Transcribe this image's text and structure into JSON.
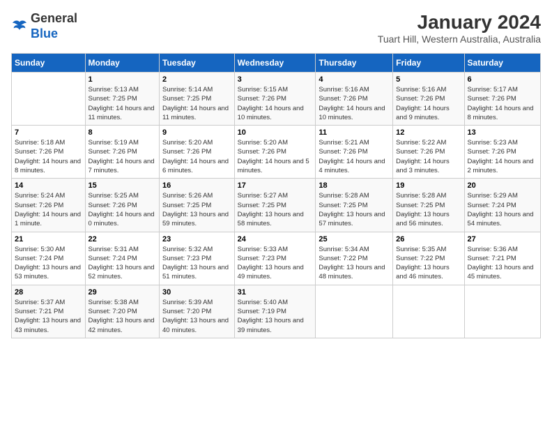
{
  "logo": {
    "general": "General",
    "blue": "Blue"
  },
  "title": "January 2024",
  "subtitle": "Tuart Hill, Western Australia, Australia",
  "days_of_week": [
    "Sunday",
    "Monday",
    "Tuesday",
    "Wednesday",
    "Thursday",
    "Friday",
    "Saturday"
  ],
  "weeks": [
    [
      {
        "day": "",
        "sunrise": "",
        "sunset": "",
        "daylight": ""
      },
      {
        "day": "1",
        "sunrise": "Sunrise: 5:13 AM",
        "sunset": "Sunset: 7:25 PM",
        "daylight": "Daylight: 14 hours and 11 minutes."
      },
      {
        "day": "2",
        "sunrise": "Sunrise: 5:14 AM",
        "sunset": "Sunset: 7:25 PM",
        "daylight": "Daylight: 14 hours and 11 minutes."
      },
      {
        "day": "3",
        "sunrise": "Sunrise: 5:15 AM",
        "sunset": "Sunset: 7:26 PM",
        "daylight": "Daylight: 14 hours and 10 minutes."
      },
      {
        "day": "4",
        "sunrise": "Sunrise: 5:16 AM",
        "sunset": "Sunset: 7:26 PM",
        "daylight": "Daylight: 14 hours and 10 minutes."
      },
      {
        "day": "5",
        "sunrise": "Sunrise: 5:16 AM",
        "sunset": "Sunset: 7:26 PM",
        "daylight": "Daylight: 14 hours and 9 minutes."
      },
      {
        "day": "6",
        "sunrise": "Sunrise: 5:17 AM",
        "sunset": "Sunset: 7:26 PM",
        "daylight": "Daylight: 14 hours and 8 minutes."
      }
    ],
    [
      {
        "day": "7",
        "sunrise": "Sunrise: 5:18 AM",
        "sunset": "Sunset: 7:26 PM",
        "daylight": "Daylight: 14 hours and 8 minutes."
      },
      {
        "day": "8",
        "sunrise": "Sunrise: 5:19 AM",
        "sunset": "Sunset: 7:26 PM",
        "daylight": "Daylight: 14 hours and 7 minutes."
      },
      {
        "day": "9",
        "sunrise": "Sunrise: 5:20 AM",
        "sunset": "Sunset: 7:26 PM",
        "daylight": "Daylight: 14 hours and 6 minutes."
      },
      {
        "day": "10",
        "sunrise": "Sunrise: 5:20 AM",
        "sunset": "Sunset: 7:26 PM",
        "daylight": "Daylight: 14 hours and 5 minutes."
      },
      {
        "day": "11",
        "sunrise": "Sunrise: 5:21 AM",
        "sunset": "Sunset: 7:26 PM",
        "daylight": "Daylight: 14 hours and 4 minutes."
      },
      {
        "day": "12",
        "sunrise": "Sunrise: 5:22 AM",
        "sunset": "Sunset: 7:26 PM",
        "daylight": "Daylight: 14 hours and 3 minutes."
      },
      {
        "day": "13",
        "sunrise": "Sunrise: 5:23 AM",
        "sunset": "Sunset: 7:26 PM",
        "daylight": "Daylight: 14 hours and 2 minutes."
      }
    ],
    [
      {
        "day": "14",
        "sunrise": "Sunrise: 5:24 AM",
        "sunset": "Sunset: 7:26 PM",
        "daylight": "Daylight: 14 hours and 1 minute."
      },
      {
        "day": "15",
        "sunrise": "Sunrise: 5:25 AM",
        "sunset": "Sunset: 7:26 PM",
        "daylight": "Daylight: 14 hours and 0 minutes."
      },
      {
        "day": "16",
        "sunrise": "Sunrise: 5:26 AM",
        "sunset": "Sunset: 7:25 PM",
        "daylight": "Daylight: 13 hours and 59 minutes."
      },
      {
        "day": "17",
        "sunrise": "Sunrise: 5:27 AM",
        "sunset": "Sunset: 7:25 PM",
        "daylight": "Daylight: 13 hours and 58 minutes."
      },
      {
        "day": "18",
        "sunrise": "Sunrise: 5:28 AM",
        "sunset": "Sunset: 7:25 PM",
        "daylight": "Daylight: 13 hours and 57 minutes."
      },
      {
        "day": "19",
        "sunrise": "Sunrise: 5:28 AM",
        "sunset": "Sunset: 7:25 PM",
        "daylight": "Daylight: 13 hours and 56 minutes."
      },
      {
        "day": "20",
        "sunrise": "Sunrise: 5:29 AM",
        "sunset": "Sunset: 7:24 PM",
        "daylight": "Daylight: 13 hours and 54 minutes."
      }
    ],
    [
      {
        "day": "21",
        "sunrise": "Sunrise: 5:30 AM",
        "sunset": "Sunset: 7:24 PM",
        "daylight": "Daylight: 13 hours and 53 minutes."
      },
      {
        "day": "22",
        "sunrise": "Sunrise: 5:31 AM",
        "sunset": "Sunset: 7:24 PM",
        "daylight": "Daylight: 13 hours and 52 minutes."
      },
      {
        "day": "23",
        "sunrise": "Sunrise: 5:32 AM",
        "sunset": "Sunset: 7:23 PM",
        "daylight": "Daylight: 13 hours and 51 minutes."
      },
      {
        "day": "24",
        "sunrise": "Sunrise: 5:33 AM",
        "sunset": "Sunset: 7:23 PM",
        "daylight": "Daylight: 13 hours and 49 minutes."
      },
      {
        "day": "25",
        "sunrise": "Sunrise: 5:34 AM",
        "sunset": "Sunset: 7:22 PM",
        "daylight": "Daylight: 13 hours and 48 minutes."
      },
      {
        "day": "26",
        "sunrise": "Sunrise: 5:35 AM",
        "sunset": "Sunset: 7:22 PM",
        "daylight": "Daylight: 13 hours and 46 minutes."
      },
      {
        "day": "27",
        "sunrise": "Sunrise: 5:36 AM",
        "sunset": "Sunset: 7:21 PM",
        "daylight": "Daylight: 13 hours and 45 minutes."
      }
    ],
    [
      {
        "day": "28",
        "sunrise": "Sunrise: 5:37 AM",
        "sunset": "Sunset: 7:21 PM",
        "daylight": "Daylight: 13 hours and 43 minutes."
      },
      {
        "day": "29",
        "sunrise": "Sunrise: 5:38 AM",
        "sunset": "Sunset: 7:20 PM",
        "daylight": "Daylight: 13 hours and 42 minutes."
      },
      {
        "day": "30",
        "sunrise": "Sunrise: 5:39 AM",
        "sunset": "Sunset: 7:20 PM",
        "daylight": "Daylight: 13 hours and 40 minutes."
      },
      {
        "day": "31",
        "sunrise": "Sunrise: 5:40 AM",
        "sunset": "Sunset: 7:19 PM",
        "daylight": "Daylight: 13 hours and 39 minutes."
      },
      {
        "day": "",
        "sunrise": "",
        "sunset": "",
        "daylight": ""
      },
      {
        "day": "",
        "sunrise": "",
        "sunset": "",
        "daylight": ""
      },
      {
        "day": "",
        "sunrise": "",
        "sunset": "",
        "daylight": ""
      }
    ]
  ]
}
